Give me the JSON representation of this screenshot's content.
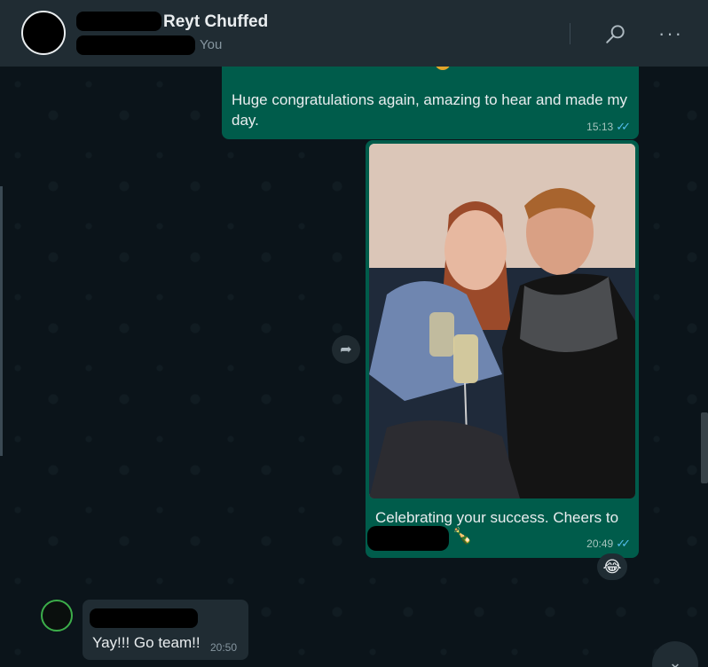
{
  "header": {
    "contact_name": "Reyt Chuffed",
    "subtitle": "You",
    "search_icon": "search-icon",
    "more_icon": "more-options-icon",
    "more_glyph": "···"
  },
  "messages": [
    {
      "direction": "outgoing",
      "text": "Huge congratulations again, amazing to hear and made my day.",
      "time": "15:13",
      "status": "read"
    },
    {
      "direction": "outgoing",
      "type": "image",
      "caption": "Celebrating your success. Cheers to",
      "caption_emoji": "🍾",
      "time": "20:49",
      "status": "read",
      "reaction": "😂"
    },
    {
      "direction": "incoming",
      "text": "Yay!!! Go team!!",
      "time": "20:50"
    }
  ],
  "colors": {
    "header_bg": "#202c33",
    "chat_bg": "#0b141a",
    "outgoing_bubble": "#005c4b",
    "incoming_bubble": "#202c33",
    "read_ticks": "#53bdeb"
  },
  "icons": {
    "forward": "forward-icon",
    "scroll_down": "chevron-down-icon",
    "ticks": "double-check-icon"
  },
  "glyphs": {
    "forward": "➦",
    "scroll_down": "⌄",
    "ticks": "✓✓"
  }
}
